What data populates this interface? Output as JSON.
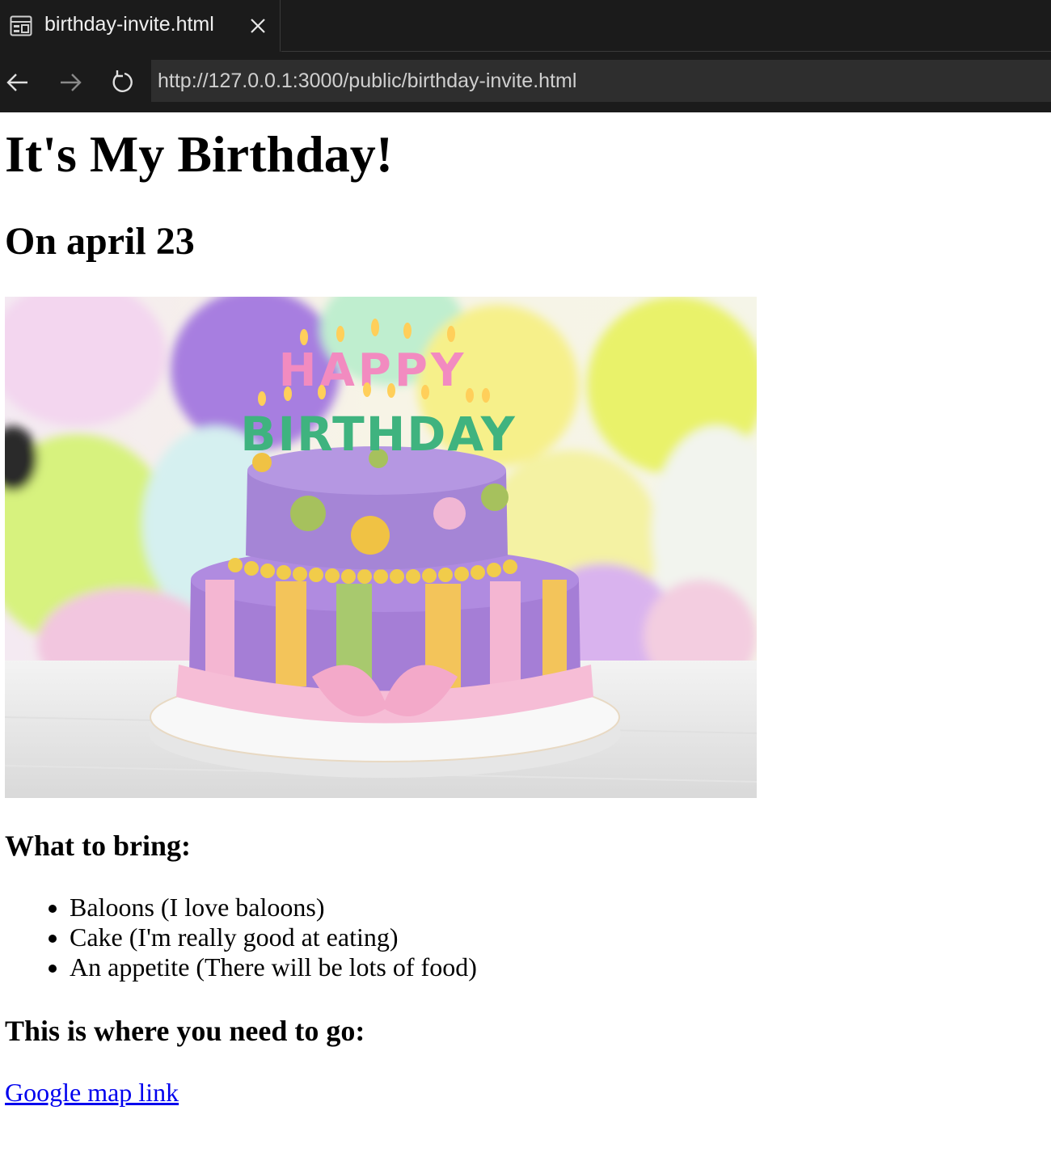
{
  "browser": {
    "tab_title": "birthday-invite.html",
    "url": "http://127.0.0.1:3000/public/birthday-invite.html"
  },
  "page": {
    "title": "It's My Birthday!",
    "date_heading": "On april 23",
    "image": {
      "cake_lettering_top": "HAPPY",
      "cake_lettering_bottom": "BIRTHDAY"
    },
    "bring_heading": "What to bring:",
    "bring_items": [
      "Baloons (I love baloons)",
      "Cake (I'm really good at eating)",
      "An appetite (There will be lots of food)"
    ],
    "location_heading": "This is where you need to go:",
    "map_link_text": "Google map link"
  },
  "colors": {
    "chrome_background": "#1b1b1b",
    "url_bar": "#2e2e2e",
    "link": "#0000ee"
  }
}
